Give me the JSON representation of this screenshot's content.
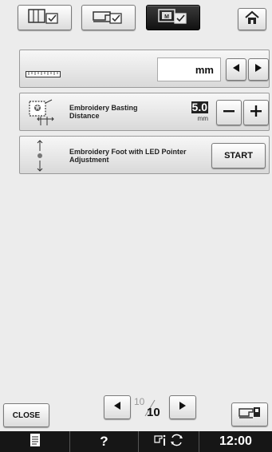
{
  "tabs": {
    "tab1_icon": "page-settings-icon",
    "tab2_icon": "machine-settings-icon",
    "tab3_icon": "embroidery-settings-icon",
    "home_icon": "home-icon"
  },
  "unit_row": {
    "value": "mm"
  },
  "basting_row": {
    "label": "Embroidery Basting Distance",
    "value": "5.0",
    "unit": "mm"
  },
  "led_row": {
    "label": "Embroidery Foot with LED Pointer Adjustment",
    "start_label": "START"
  },
  "footer": {
    "close_label": "CLOSE",
    "page_current": "10",
    "page_total": "10"
  },
  "statusbar": {
    "help": "?",
    "time": "12:00"
  }
}
